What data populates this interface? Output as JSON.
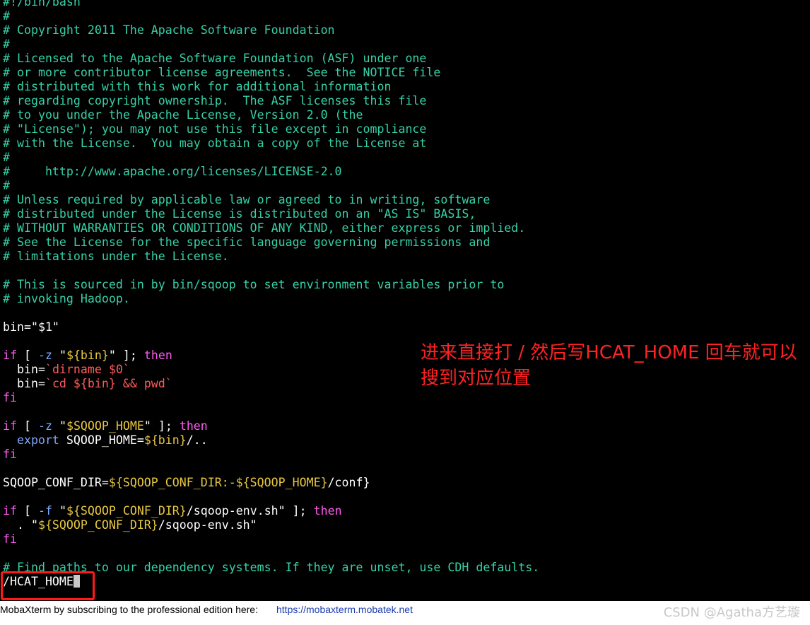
{
  "terminal": {
    "lines": {
      "l0": "#!/bin/bash",
      "l1": "#",
      "l2": "# Copyright 2011 The Apache Software Foundation",
      "l3": "#",
      "l4": "# Licensed to the Apache Software Foundation (ASF) under one",
      "l5": "# or more contributor license agreements.  See the NOTICE file",
      "l6": "# distributed with this work for additional information",
      "l7": "# regarding copyright ownership.  The ASF licenses this file",
      "l8": "# to you under the Apache License, Version 2.0 (the",
      "l9": "# \"License\"); you may not use this file except in compliance",
      "l10": "# with the License.  You may obtain a copy of the License at",
      "l11": "#",
      "l12": "#     http://www.apache.org/licenses/LICENSE-2.0",
      "l13": "#",
      "l14": "# Unless required by applicable law or agreed to in writing, software",
      "l15": "# distributed under the License is distributed on an \"AS IS\" BASIS,",
      "l16": "# WITHOUT WARRANTIES OR CONDITIONS OF ANY KIND, either express or implied.",
      "l17": "# See the License for the specific language governing permissions and",
      "l18": "# limitations under the License.",
      "l20": "# This is sourced in by bin/sqoop to set environment variables prior to",
      "l21": "# invoking Hadoop.",
      "l40": "# Find paths to our dependency systems. If they are unset, use CDH defaults."
    },
    "code": {
      "bin_assign": "bin=\"$1\"",
      "if1_if": "if",
      "if1_mid1": " [ ",
      "if1_flag": "-z",
      "if1_sp": " ",
      "if1_q1": "\"",
      "if1_var": "${bin}",
      "if1_q2": "\"",
      "if1_mid2": " ]; ",
      "if1_then": "then",
      "dirname_pre": "  bin=",
      "dirname_cmd": "`dirname $0`",
      "cd_pre": "  bin=",
      "cd_cmd": "`cd ${bin} && pwd`",
      "fi": "fi",
      "if2_if": "if",
      "if2_mid1": " [ ",
      "if2_flag": "-z",
      "if2_sp": " ",
      "if2_q1": "\"",
      "if2_var": "$SQOOP_HOME",
      "if2_q2": "\"",
      "if2_mid2": " ]; ",
      "if2_then": "then",
      "export_indent": "  ",
      "export_kw": "export",
      "export_name": " SQOOP_HOME=",
      "export_var": "${bin}",
      "export_rest": "/..",
      "conf_name": "SQOOP_CONF_DIR=",
      "conf_var1": "${SQOOP_CONF_DIR:-",
      "conf_var2": "${SQOOP_HOME}",
      "conf_rest": "/conf}",
      "if3_if": "if",
      "if3_mid1": " [ ",
      "if3_flag": "-f",
      "if3_sp": " ",
      "if3_q1": "\"",
      "if3_var": "${SQOOP_CONF_DIR}",
      "if3_path": "/sqoop-env.sh\"",
      "if3_mid2": " ]; ",
      "if3_then": "then",
      "src_pre": "  . \"",
      "src_var": "${SQOOP_CONF_DIR}",
      "src_rest": "/sqoop-env.sh\""
    },
    "command_input": "/HCAT_HOME"
  },
  "annotation": "进来直接打 / 然后写HCAT_HOME 回车就可以搜到对应位置",
  "statusbar": {
    "text": "MobaXterm by subscribing to the professional edition here:",
    "link": "https://mobaxterm.mobatek.net"
  },
  "watermark": "CSDN @Agatha方艺璇",
  "colors": {
    "background": "#000000",
    "comment": "#36d1a7",
    "keyword": "#ff5bf0",
    "variable": "#e8c840",
    "backtick": "#ff5b5b",
    "annotation": "#ff2222",
    "highlight_box": "#ff1a1a"
  }
}
